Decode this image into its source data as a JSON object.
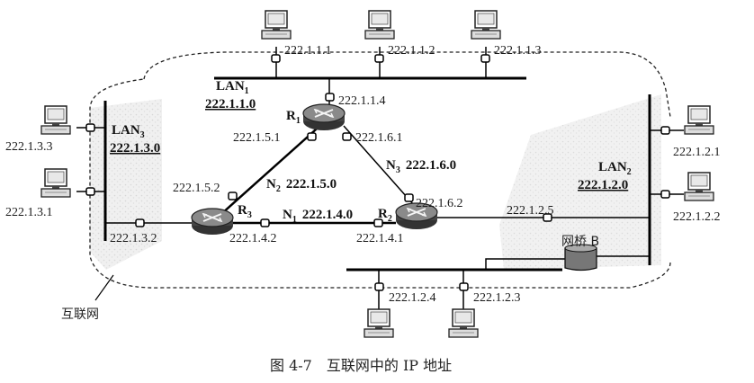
{
  "caption": "图 4-7　互联网中的 IP 地址",
  "internet_label": "互联网",
  "bridge_label": "网桥 B",
  "lans": {
    "lan1": {
      "name": "LAN",
      "sub": "1",
      "net": "222.1.1.0"
    },
    "lan2": {
      "name": "LAN",
      "sub": "2",
      "net": "222.1.2.0"
    },
    "lan3": {
      "name": "LAN",
      "sub": "3",
      "net": "222.1.3.0"
    }
  },
  "routers": {
    "r1": {
      "name": "R",
      "sub": "1"
    },
    "r2": {
      "name": "R",
      "sub": "2"
    },
    "r3": {
      "name": "R",
      "sub": "3"
    }
  },
  "links": {
    "n1": {
      "name": "N",
      "sub": "1",
      "net": "222.1.4.0"
    },
    "n2": {
      "name": "N",
      "sub": "2",
      "net": "222.1.5.0"
    },
    "n3": {
      "name": "N",
      "sub": "3",
      "net": "222.1.6.0"
    }
  },
  "hosts": {
    "h111": "222.1.1.1",
    "h112": "222.1.1.2",
    "h113": "222.1.1.3",
    "h121": "222.1.2.1",
    "h122": "222.1.2.2",
    "h123": "222.1.2.3",
    "h124": "222.1.2.4",
    "h131": "222.1.3.1",
    "h133": "222.1.3.3"
  },
  "interfaces": {
    "r1_lan1": "222.1.1.4",
    "r1_n2": "222.1.5.1",
    "r1_n3": "222.1.6.1",
    "r3_n2": "222.1.5.2",
    "r3_lan3": "222.1.3.2",
    "r3_n1": "222.1.4.2",
    "r2_n1": "222.1.4.1",
    "r2_n3": "222.1.6.2",
    "r2_lan2": "222.1.2.5"
  }
}
